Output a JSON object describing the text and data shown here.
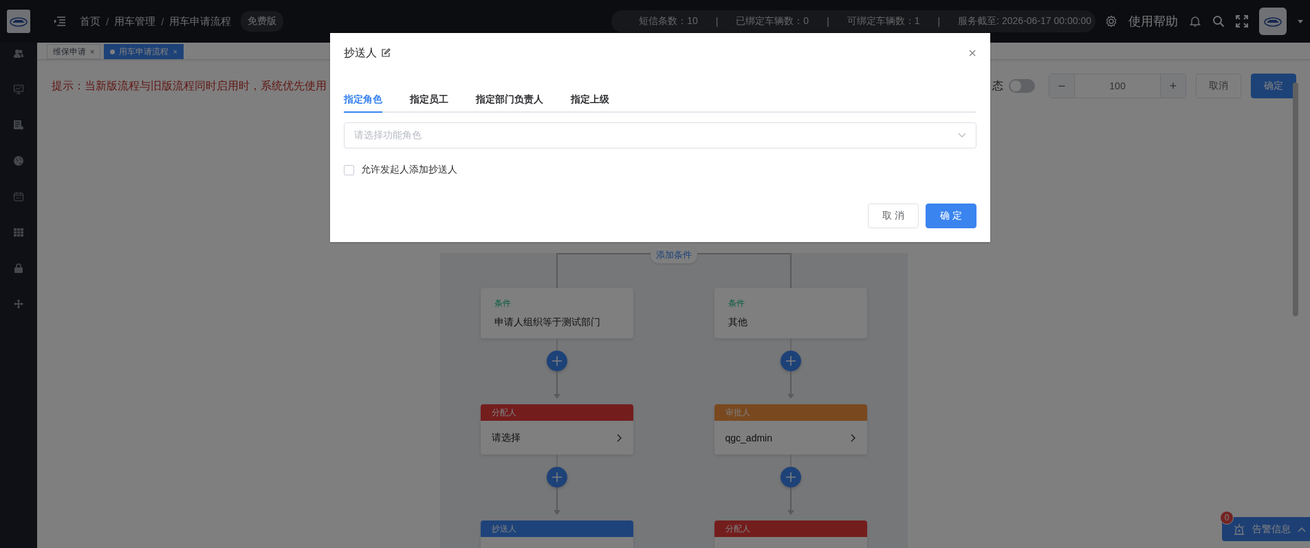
{
  "top_bar": {
    "breadcrumbs": [
      "首页",
      "用车管理",
      "用车申请流程"
    ],
    "separator": "/",
    "edition": "免费版",
    "stats": [
      "短信条数：10",
      "已绑定车辆数：0",
      "可绑定车辆数：1",
      "服务截至: 2026-06-17 00:00:00"
    ],
    "stat_separator": "|",
    "help": "使用帮助"
  },
  "tabs": [
    {
      "label": "维保申请",
      "selected": false,
      "close": "×"
    },
    {
      "label": "用车申请流程",
      "selected": true,
      "close": "×"
    }
  ],
  "hint": "提示：当新版流程与旧版流程同时启用时，系统优先使用",
  "toolbar": {
    "status_label": "态",
    "status_switch": {
      "on": false
    },
    "zoom": {
      "minus": "−",
      "value": "100",
      "plus": "+"
    },
    "buttons": [
      {
        "label": "取消",
        "kind": "default"
      },
      {
        "label": "确定",
        "kind": "primary"
      }
    ]
  },
  "flow": {
    "add_condition": "添加条件",
    "branches": [
      {
        "condition_label": "条件",
        "condition": "申请人组织等于测试部门",
        "nodes": [
          {
            "kind": "assignee",
            "title": "分配人",
            "value": "请选择"
          },
          {
            "kind": "cc",
            "title": "抄送人"
          }
        ]
      },
      {
        "condition_label": "条件",
        "condition": "其他",
        "nodes": [
          {
            "kind": "approver",
            "title": "审批人",
            "value": "qgc_admin"
          },
          {
            "kind": "assignee",
            "title": "分配人"
          }
        ]
      }
    ]
  },
  "alarm": {
    "count": "0",
    "label": "告警信息"
  },
  "dialog": {
    "title": "抄送人",
    "close": "×",
    "tabs": [
      {
        "label": "指定角色",
        "selected": true
      },
      {
        "label": "指定员工",
        "selected": false
      },
      {
        "label": "指定部门负责人",
        "selected": false
      },
      {
        "label": "指定上级",
        "selected": false
      }
    ],
    "select": {
      "placeholder": "请选择功能角色"
    },
    "allow_add": {
      "label": "允许发起人添加抄送人",
      "checked": false
    },
    "buttons": [
      {
        "label": "取 消",
        "kind": "default"
      },
      {
        "label": "确 定",
        "kind": "primary"
      }
    ]
  }
}
